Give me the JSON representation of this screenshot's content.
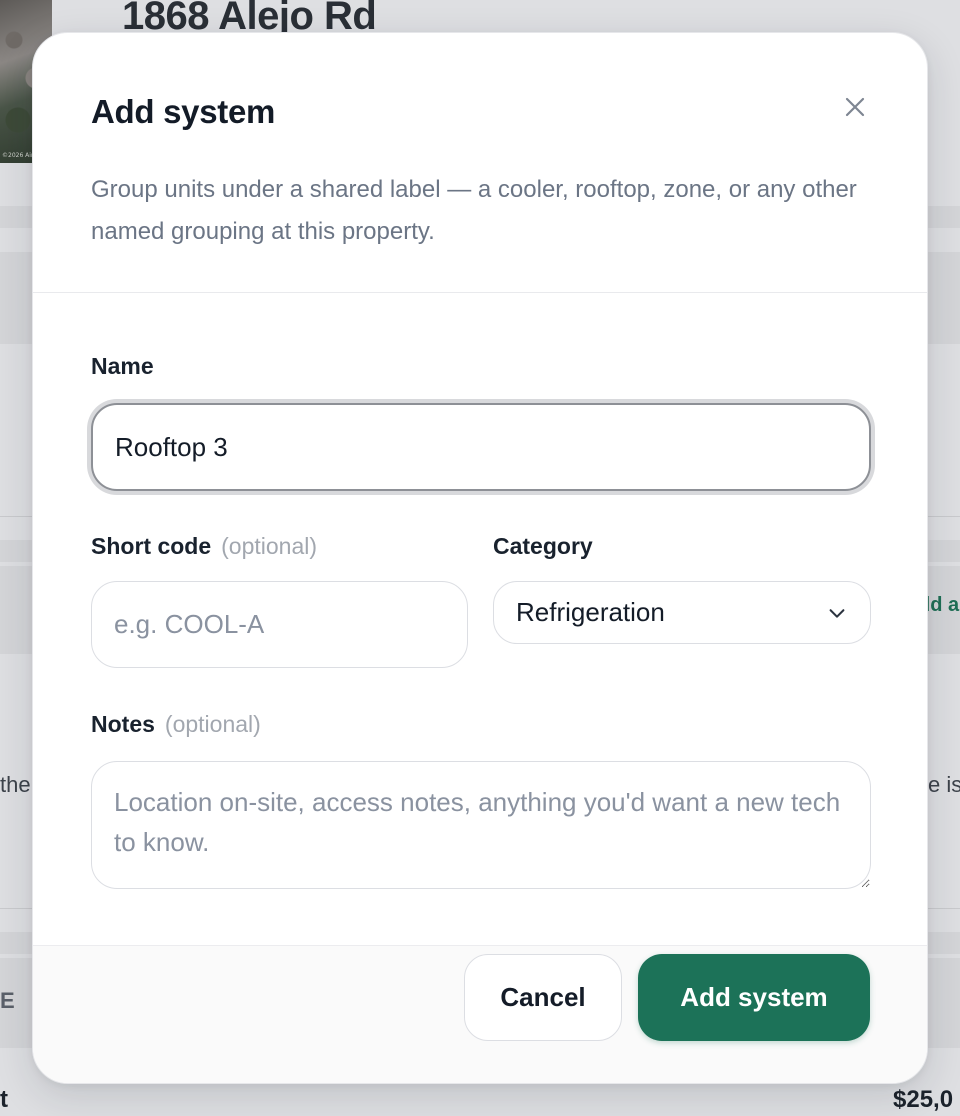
{
  "background": {
    "property_title": "1868 Alejo Rd",
    "thumbnail_credit": "©2026 Airbus",
    "right_link_fragment": "dd a",
    "left_text_fragment": "the",
    "right_text_fragment": "e is",
    "column_fragment": "E",
    "left_bottom_fragment": "t",
    "price_fragment": "$25,0"
  },
  "modal": {
    "title": "Add system",
    "description": "Group units under a shared label — a cooler, rooftop, zone, or any other named grouping at this property.",
    "close_icon": "close-icon",
    "name": {
      "label": "Name",
      "value": "Rooftop 3"
    },
    "short_code": {
      "label": "Short code",
      "optional": "(optional)",
      "placeholder": "e.g. COOL-A",
      "value": ""
    },
    "category": {
      "label": "Category",
      "selected": "Refrigeration",
      "icon": "chevron-down-icon"
    },
    "notes": {
      "label": "Notes",
      "optional": "(optional)",
      "placeholder": "Location on-site, access notes, anything you'd want a new tech to know.",
      "value": ""
    },
    "buttons": {
      "cancel": "Cancel",
      "submit": "Add system"
    },
    "colors": {
      "primary": "#1c7258",
      "overlay": "#dedfe2"
    }
  }
}
